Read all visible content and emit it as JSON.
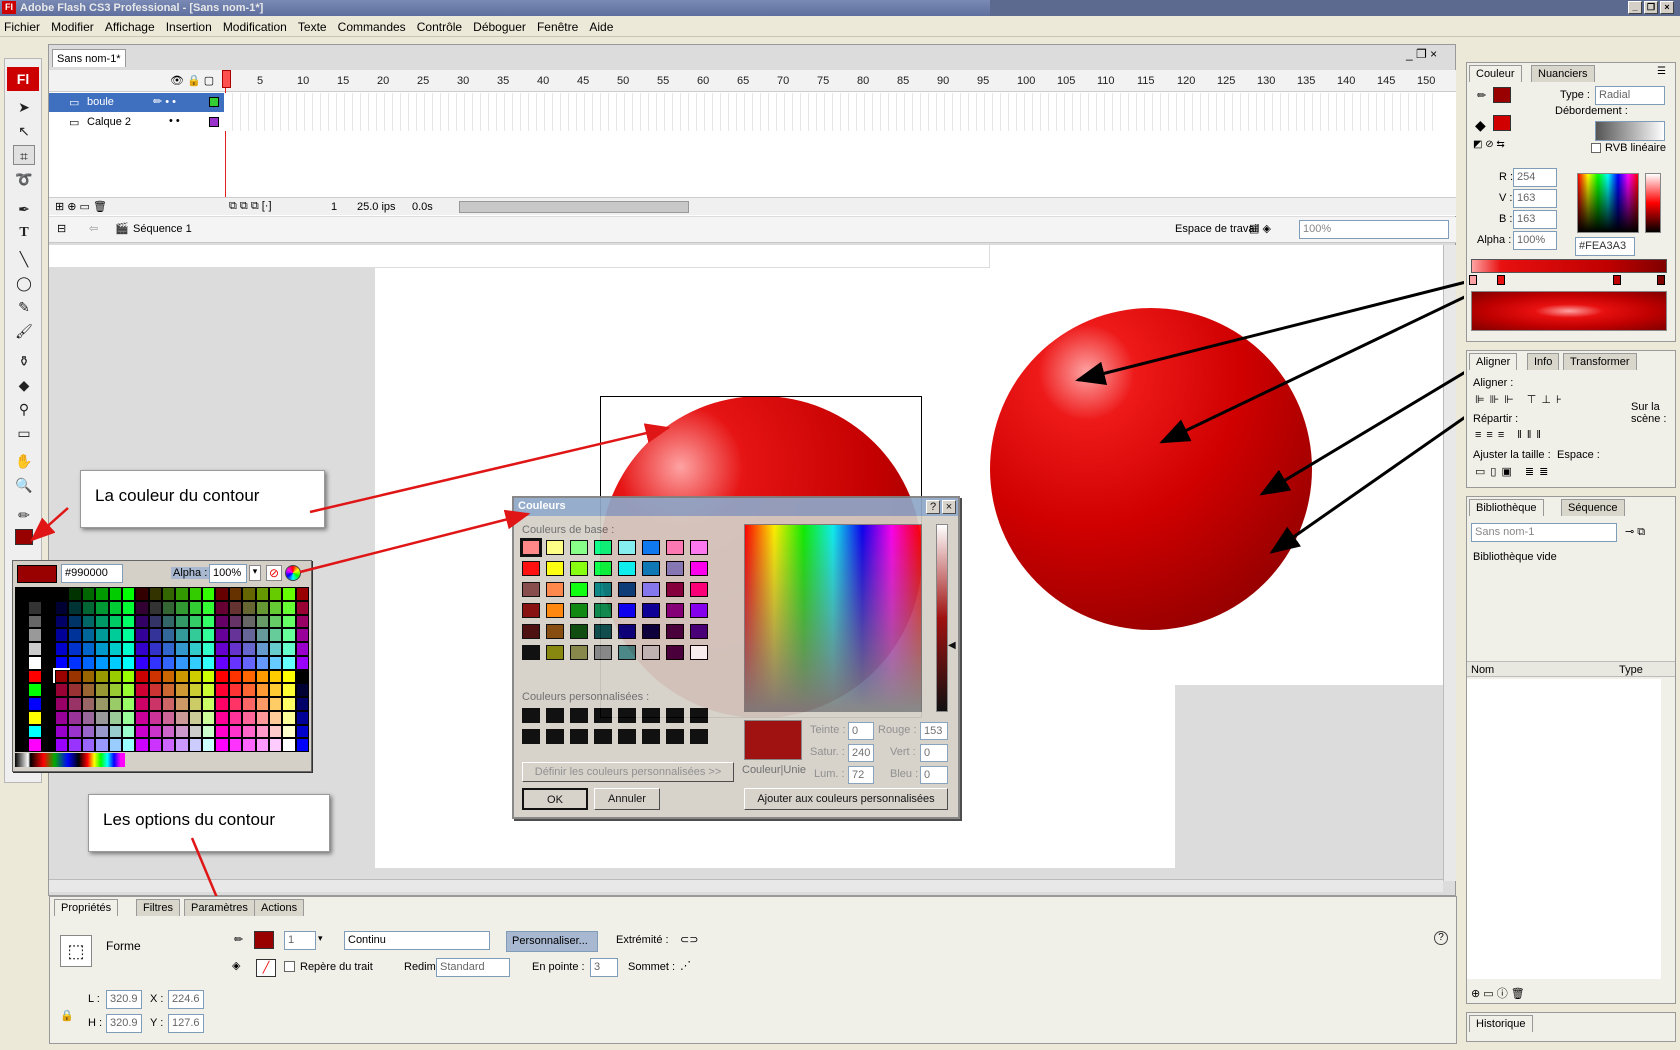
{
  "window": {
    "title": "Adobe Flash CS3 Professional - [Sans nom-1*]",
    "logo": "Fl"
  },
  "menu": [
    "Fichier",
    "Modifier",
    "Affichage",
    "Insertion",
    "Modification",
    "Texte",
    "Commandes",
    "Contrôle",
    "Déboguer",
    "Fenêtre",
    "Aide"
  ],
  "document": {
    "tab": "Sans nom-1*",
    "scene": "Séquence 1",
    "workspace": "Espace de travail",
    "zoom": "100%"
  },
  "timeline": {
    "frame_numbers": [
      "1",
      "5",
      "10",
      "15",
      "20",
      "25",
      "30",
      "35",
      "40",
      "45",
      "50",
      "55",
      "60",
      "65",
      "70",
      "75",
      "80",
      "85",
      "90",
      "95",
      "100",
      "105",
      "110",
      "115",
      "120",
      "125",
      "130",
      "135",
      "140",
      "145",
      "150"
    ],
    "layers": [
      {
        "name": "boule",
        "color": "#33cc33"
      },
      {
        "name": "Calque 2",
        "color": "#9933cc"
      }
    ],
    "current_frame": "1",
    "fps": "25.0 ips",
    "time": "0.0s"
  },
  "swatches_popup": {
    "hex": "#990000",
    "alpha_label": "Alpha :",
    "alpha": "100%"
  },
  "colors_dialog": {
    "title": "Couleurs",
    "basic_label": "Couleurs de base :",
    "custom_label": "Couleurs personnalisées :",
    "define_button": "Définir les couleurs personnalisées >>",
    "ok": "OK",
    "cancel": "Annuler",
    "add_button": "Ajouter aux couleurs personnalisées",
    "solid_label": "Couleur|Unie",
    "hue_label": "Teinte :",
    "hue": "0",
    "sat_label": "Satur. :",
    "sat": "240",
    "lum_label": "Lum. :",
    "lum": "72",
    "red_label": "Rouge :",
    "red": "153",
    "green_label": "Vert :",
    "green": "0",
    "blue_label": "Bleu :",
    "blue": "0",
    "help": "?",
    "close": "×"
  },
  "callouts": {
    "stroke_color": "La couleur du contour",
    "stroke_options": "Les options du contour"
  },
  "color_panel": {
    "tab_color": "Couleur",
    "tab_swatches": "Nuanciers",
    "type_label": "Type :",
    "type": "Radial",
    "overflow_label": "Débordement :",
    "linear_rgb": "RVB linéaire",
    "r_label": "R :",
    "r": "254",
    "g_label": "V :",
    "g": "163",
    "b_label": "B :",
    "b": "163",
    "alpha_label": "Alpha :",
    "alpha": "100%",
    "hex": "#FEA3A3"
  },
  "align_panel": {
    "tabs": [
      "Aligner",
      "Info",
      "Transformer"
    ],
    "align_label": "Aligner :",
    "distribute_label": "Répartir :",
    "match_size_label": "Ajuster la taille :",
    "space_label": "Espace :",
    "to_stage_label": "Sur la scène :"
  },
  "library_panel": {
    "tabs": [
      "Bibliothèque",
      "Séquence"
    ],
    "document": "Sans nom-1",
    "empty": "Bibliothèque vide",
    "col_name": "Nom",
    "col_type": "Type"
  },
  "history_panel": {
    "tab": "Historique"
  },
  "properties": {
    "tabs": [
      "Propriétés",
      "Filtres",
      "Paramètres",
      "Actions"
    ],
    "shape_label": "Forme",
    "stroke_height": "1",
    "stroke_style": "Continu",
    "custom_button": "Personnaliser...",
    "cap_label": "Extrémité :",
    "hinting_label": "Repère du trait",
    "scale_label": "Redim. :",
    "scale": "Standard",
    "miter_label": "En pointe :",
    "miter": "3",
    "join_label": "Sommet :",
    "w_label": "L :",
    "w": "320.9",
    "h_label": "H :",
    "h": "320.9",
    "x_label": "X :",
    "x": "224.6",
    "y_label": "Y :",
    "y": "127.6"
  },
  "colors": {
    "stroke": "#990000",
    "fill_center": "#FEA3A3",
    "fill_mid": "#E00000",
    "fill_outer": "#800000"
  }
}
